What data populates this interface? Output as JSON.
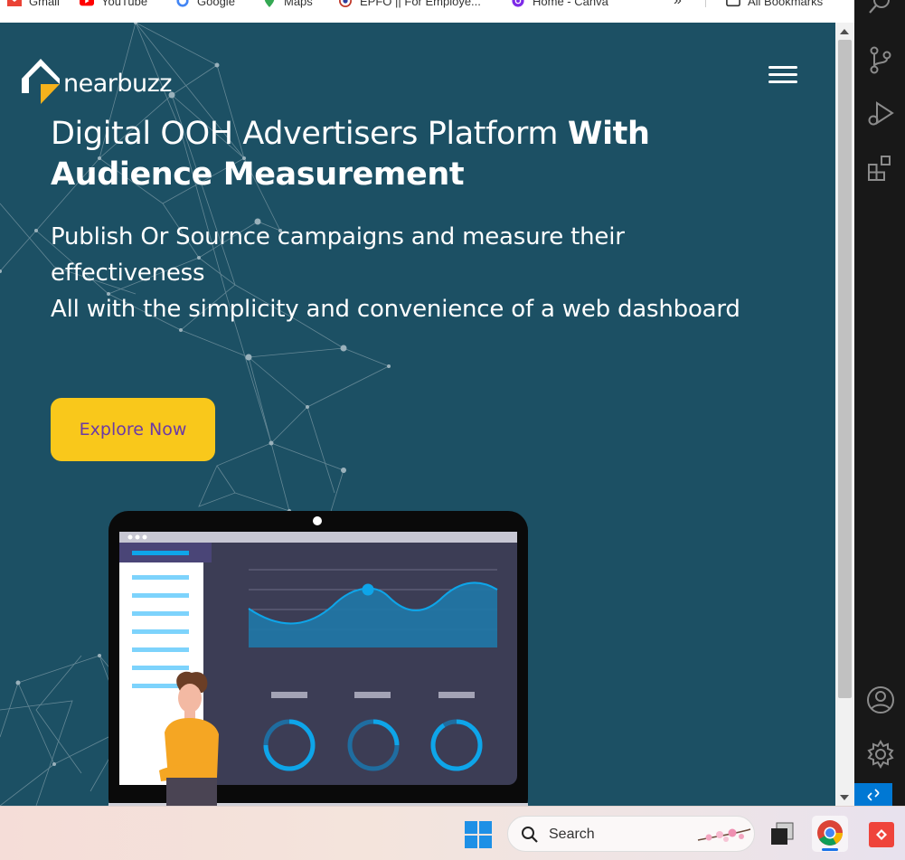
{
  "bookmarks": [
    {
      "label": "Gmail",
      "icon": "gmail-icon"
    },
    {
      "label": "YouTube",
      "icon": "youtube-icon"
    },
    {
      "label": "Google",
      "icon": "google-icon"
    },
    {
      "label": "Maps",
      "icon": "maps-icon"
    },
    {
      "label": "EPFO || For Employe...",
      "icon": "epfo-icon"
    },
    {
      "label": "Home - Canva",
      "icon": "canva-icon"
    },
    {
      "label": "»",
      "icon": ""
    },
    {
      "label": "All Bookmarks",
      "icon": "folder-icon"
    }
  ],
  "site": {
    "logo_text": "nearbuzz",
    "headline_regular": "Digital OOH Advertisers Platform ",
    "headline_bold_1": "With",
    "headline_bold_2": "Audience Measurement",
    "sub_line_1": "Publish Or Sournce campaigns and measure their",
    "sub_line_2": "effectiveness",
    "sub_line_3": "All with the simplicity and convenience of a web dashboard",
    "cta_label": "Explore Now"
  },
  "taskbar": {
    "search_placeholder": "Search"
  },
  "colors": {
    "hero_background": "#1c5064",
    "cta_background": "#f9c81b",
    "cta_text": "#6b3aa6",
    "accent_blue": "#0ea5e9"
  },
  "icons": {
    "activity_bar": [
      "search-icon",
      "source-control-icon",
      "run-debug-icon",
      "extensions-icon",
      "account-icon",
      "settings-gear-icon"
    ],
    "taskbar": [
      "windows-start-icon",
      "search-icon",
      "task-view-icon",
      "chrome-icon",
      "anydesk-icon"
    ]
  }
}
